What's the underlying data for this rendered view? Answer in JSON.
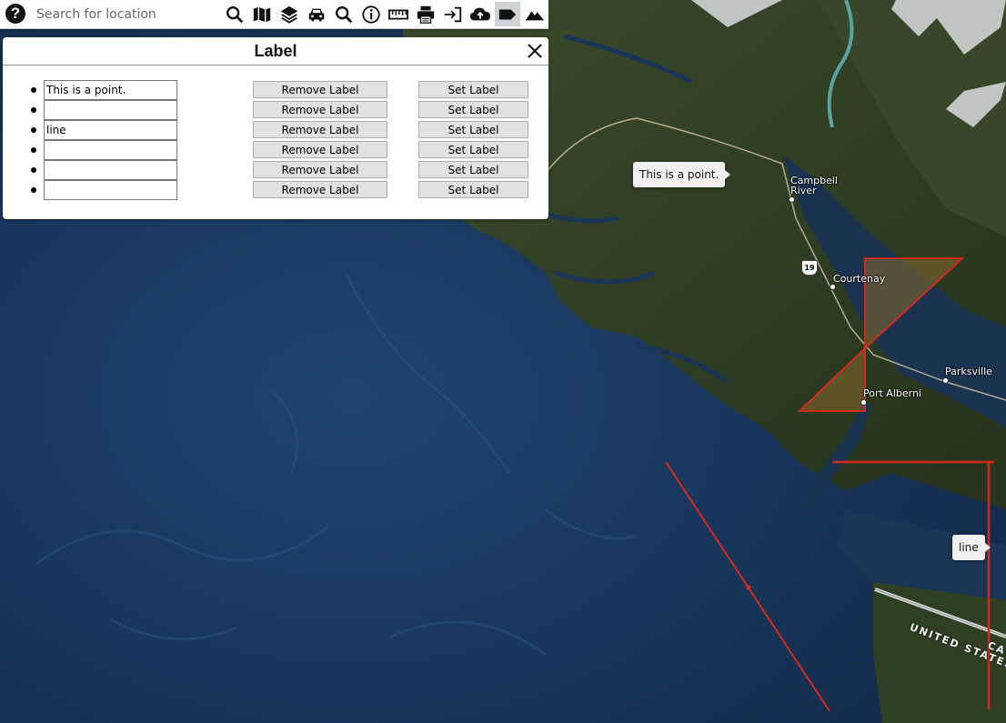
{
  "toolbar": {
    "help_label": "?",
    "search_placeholder": "Search for location",
    "tools": [
      {
        "icon": "search-icon"
      },
      {
        "icon": "map-icon"
      },
      {
        "icon": "layers-icon"
      },
      {
        "icon": "car-icon"
      },
      {
        "icon": "zoom-search-icon"
      },
      {
        "icon": "info-icon"
      },
      {
        "icon": "ruler-icon"
      },
      {
        "icon": "print-icon"
      },
      {
        "icon": "export-icon"
      },
      {
        "icon": "cloud-upload-icon"
      },
      {
        "icon": "label-icon",
        "active": true
      },
      {
        "icon": "mountain-icon"
      }
    ]
  },
  "dialog": {
    "title": "Label",
    "close_label": "close",
    "remove_label": "Remove Label",
    "set_label": "Set Label",
    "rows": [
      {
        "value": "This is a point."
      },
      {
        "value": ""
      },
      {
        "value": "line"
      },
      {
        "value": ""
      },
      {
        "value": ""
      },
      {
        "value": ""
      }
    ]
  },
  "map": {
    "labels": [
      "This is a point.",
      "line"
    ],
    "places": [
      "Campbell River",
      "Courtenay",
      "Parksville",
      "Port Alberni"
    ],
    "highway": "19",
    "border_text": "UNITED STATES",
    "border_text_2": "CA",
    "feature_color": "#d42a1e"
  }
}
